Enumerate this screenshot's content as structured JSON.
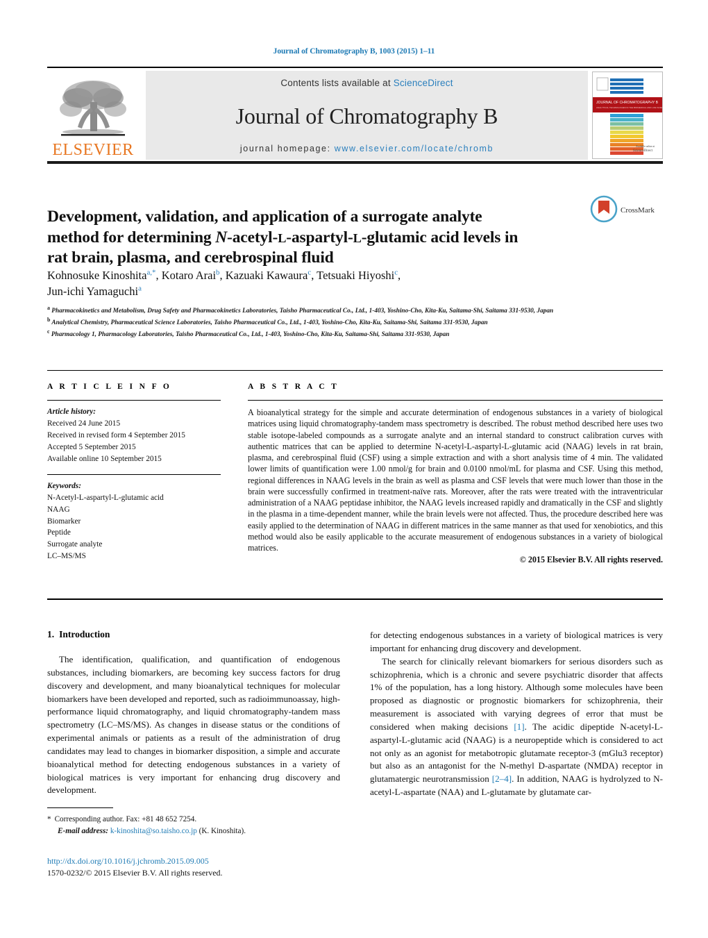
{
  "running_head": "Journal of Chromatography B, 1003 (2015) 1–11",
  "masthead": {
    "publisher_name": "ELSEVIER",
    "contents_prefix": "Contents lists available at ",
    "contents_link": "ScienceDirect",
    "journal_name": "Journal of Chromatography B",
    "homepage_prefix": "journal homepage: ",
    "homepage_link": "www.elsevier.com/locate/chromb",
    "cover_title": "JOURNAL OF CHROMATOGRAPHY B",
    "cover_publisher": "ScienceDirect"
  },
  "crossmark": {
    "label": "CrossMark"
  },
  "article": {
    "title_line1": "Development, validation, and application of a surrogate analyte",
    "title_line2_a": "method for determining ",
    "title_line2_N": "N",
    "title_line2_b": "-acetyl-",
    "title_line2_L1": "L",
    "title_line2_c": "-aspartyl-",
    "title_line2_L2": "L",
    "title_line2_d": "-glutamic acid levels in",
    "title_line3": "rat brain, plasma, and cerebrospinal fluid",
    "authors": [
      {
        "name": "Kohnosuke Kinoshita",
        "marks": "a,*"
      },
      {
        "name": "Kotaro Arai",
        "marks": "b"
      },
      {
        "name": "Kazuaki Kawaura",
        "marks": "c"
      },
      {
        "name": "Tetsuaki Hiyoshi",
        "marks": "c"
      },
      {
        "name": "Jun-ichi Yamaguchi",
        "marks": "a"
      }
    ],
    "affiliations": [
      {
        "mark": "a",
        "text": "Pharmacokinetics and Metabolism, Drug Safety and Pharmacokinetics Laboratories, Taisho Pharmaceutical Co., Ltd., 1-403, Yoshino-Cho, Kita-Ku, Saitama-Shi, Saitama 331-9530, Japan"
      },
      {
        "mark": "b",
        "text": "Analytical Chemistry, Pharmaceutical Science Laboratories, Taisho Pharmaceutical Co., Ltd., 1-403, Yoshino-Cho, Kita-Ku, Saitama-Shi, Saitama 331-9530, Japan"
      },
      {
        "mark": "c",
        "text": "Pharmacology 1, Pharmacology Laboratories, Taisho Pharmaceutical Co., Ltd., 1-403, Yoshino-Cho, Kita-Ku, Saitama-Shi, Saitama 331-9530, Japan"
      }
    ]
  },
  "article_info": {
    "heading": "A R T I C L E   I N F O",
    "history_label": "Article history:",
    "history": [
      "Received 24 June 2015",
      "Received in revised form 4 September 2015",
      "Accepted 5 September 2015",
      "Available online 10 September 2015"
    ],
    "keywords_label": "Keywords:",
    "keywords": [
      "N-Acetyl-L-aspartyl-L-glutamic acid",
      "NAAG",
      "Biomarker",
      "Peptide",
      "Surrogate analyte",
      "LC–MS/MS"
    ]
  },
  "abstract": {
    "heading": "A B S T R A C T",
    "text": "A bioanalytical strategy for the simple and accurate determination of endogenous substances in a variety of biological matrices using liquid chromatography-tandem mass spectrometry is described. The robust method described here uses two stable isotope-labeled compounds as a surrogate analyte and an internal standard to construct calibration curves with authentic matrices that can be applied to determine N-acetyl-L-aspartyl-L-glutamic acid (NAAG) levels in rat brain, plasma, and cerebrospinal fluid (CSF) using a simple extraction and with a short analysis time of 4 min. The validated lower limits of quantification were 1.00 nmol/g for brain and 0.0100 nmol/mL for plasma and CSF. Using this method, regional differences in NAAG levels in the brain as well as plasma and CSF levels that were much lower than those in the brain were successfully confirmed in treatment-naïve rats. Moreover, after the rats were treated with the intraventricular administration of a NAAG peptidase inhibitor, the NAAG levels increased rapidly and dramatically in the CSF and slightly in the plasma in a time-dependent manner, while the brain levels were not affected. Thus, the procedure described here was easily applied to the determination of NAAG in different matrices in the same manner as that used for xenobiotics, and this method would also be easily applicable to the accurate measurement of endogenous substances in a variety of biological matrices.",
    "copyright": "© 2015 Elsevier B.V. All rights reserved."
  },
  "introduction": {
    "number": "1.",
    "heading": "Introduction",
    "para1": "The identification, qualification, and quantification of endogenous substances, including biomarkers, are becoming key success factors for drug discovery and development, and many bioanalytical techniques for molecular biomarkers have been developed and reported, such as radioimmunoassay, high-performance liquid chromatography, and liquid chromatography-tandem mass spectrometry (LC–MS/MS). As changes in disease status or the conditions of experimental animals or patients as a result of the administration of drug candidates may lead to changes in biomarker disposition, a simple and accurate bioanalytical method for detecting endogenous substances in a variety of biological matrices is very important for enhancing drug discovery and development.",
    "para2_pre": "The search for clinically relevant biomarkers for serious disorders such as schizophrenia, which is a chronic and severe psychiatric disorder that affects 1% of the population, has a long history. Although some molecules have been proposed as diagnostic or prognostic biomarkers for schizophrenia, their measurement is associated with varying degrees of error that must be considered when making decisions ",
    "ref1": "[1]",
    "para2_mid": ". The acidic dipeptide N-acetyl-L-aspartyl-L-glutamic acid (NAAG) is a neuropeptide which is considered to act not only as an agonist for metabotropic glutamate receptor-3 (mGlu3 receptor) but also as an antagonist for the N-methyl D-aspartate (NMDA) receptor in glutamatergic neurotransmission ",
    "ref2": "[2–4]",
    "para2_post": ". In addition, NAAG is hydrolyzed to N-acetyl-L-aspartate (NAA) and L-glutamate by glutamate car-"
  },
  "footnote": {
    "star": "*",
    "corresponding": "Corresponding author. Fax: +81 48 652 7254.",
    "email_label": "E-mail address:",
    "email": "k-kinoshita@so.taisho.co.jp",
    "email_suffix": "(K. Kinoshita)."
  },
  "doi": {
    "url": "http://dx.doi.org/10.1016/j.jchromb.2015.09.005",
    "issn_line": "1570-0232/© 2015 Elsevier B.V. All rights reserved."
  },
  "colors": {
    "link": "#1f7bb5",
    "elsevier_orange": "#E87722",
    "band_gray": "#e9e9e9"
  }
}
